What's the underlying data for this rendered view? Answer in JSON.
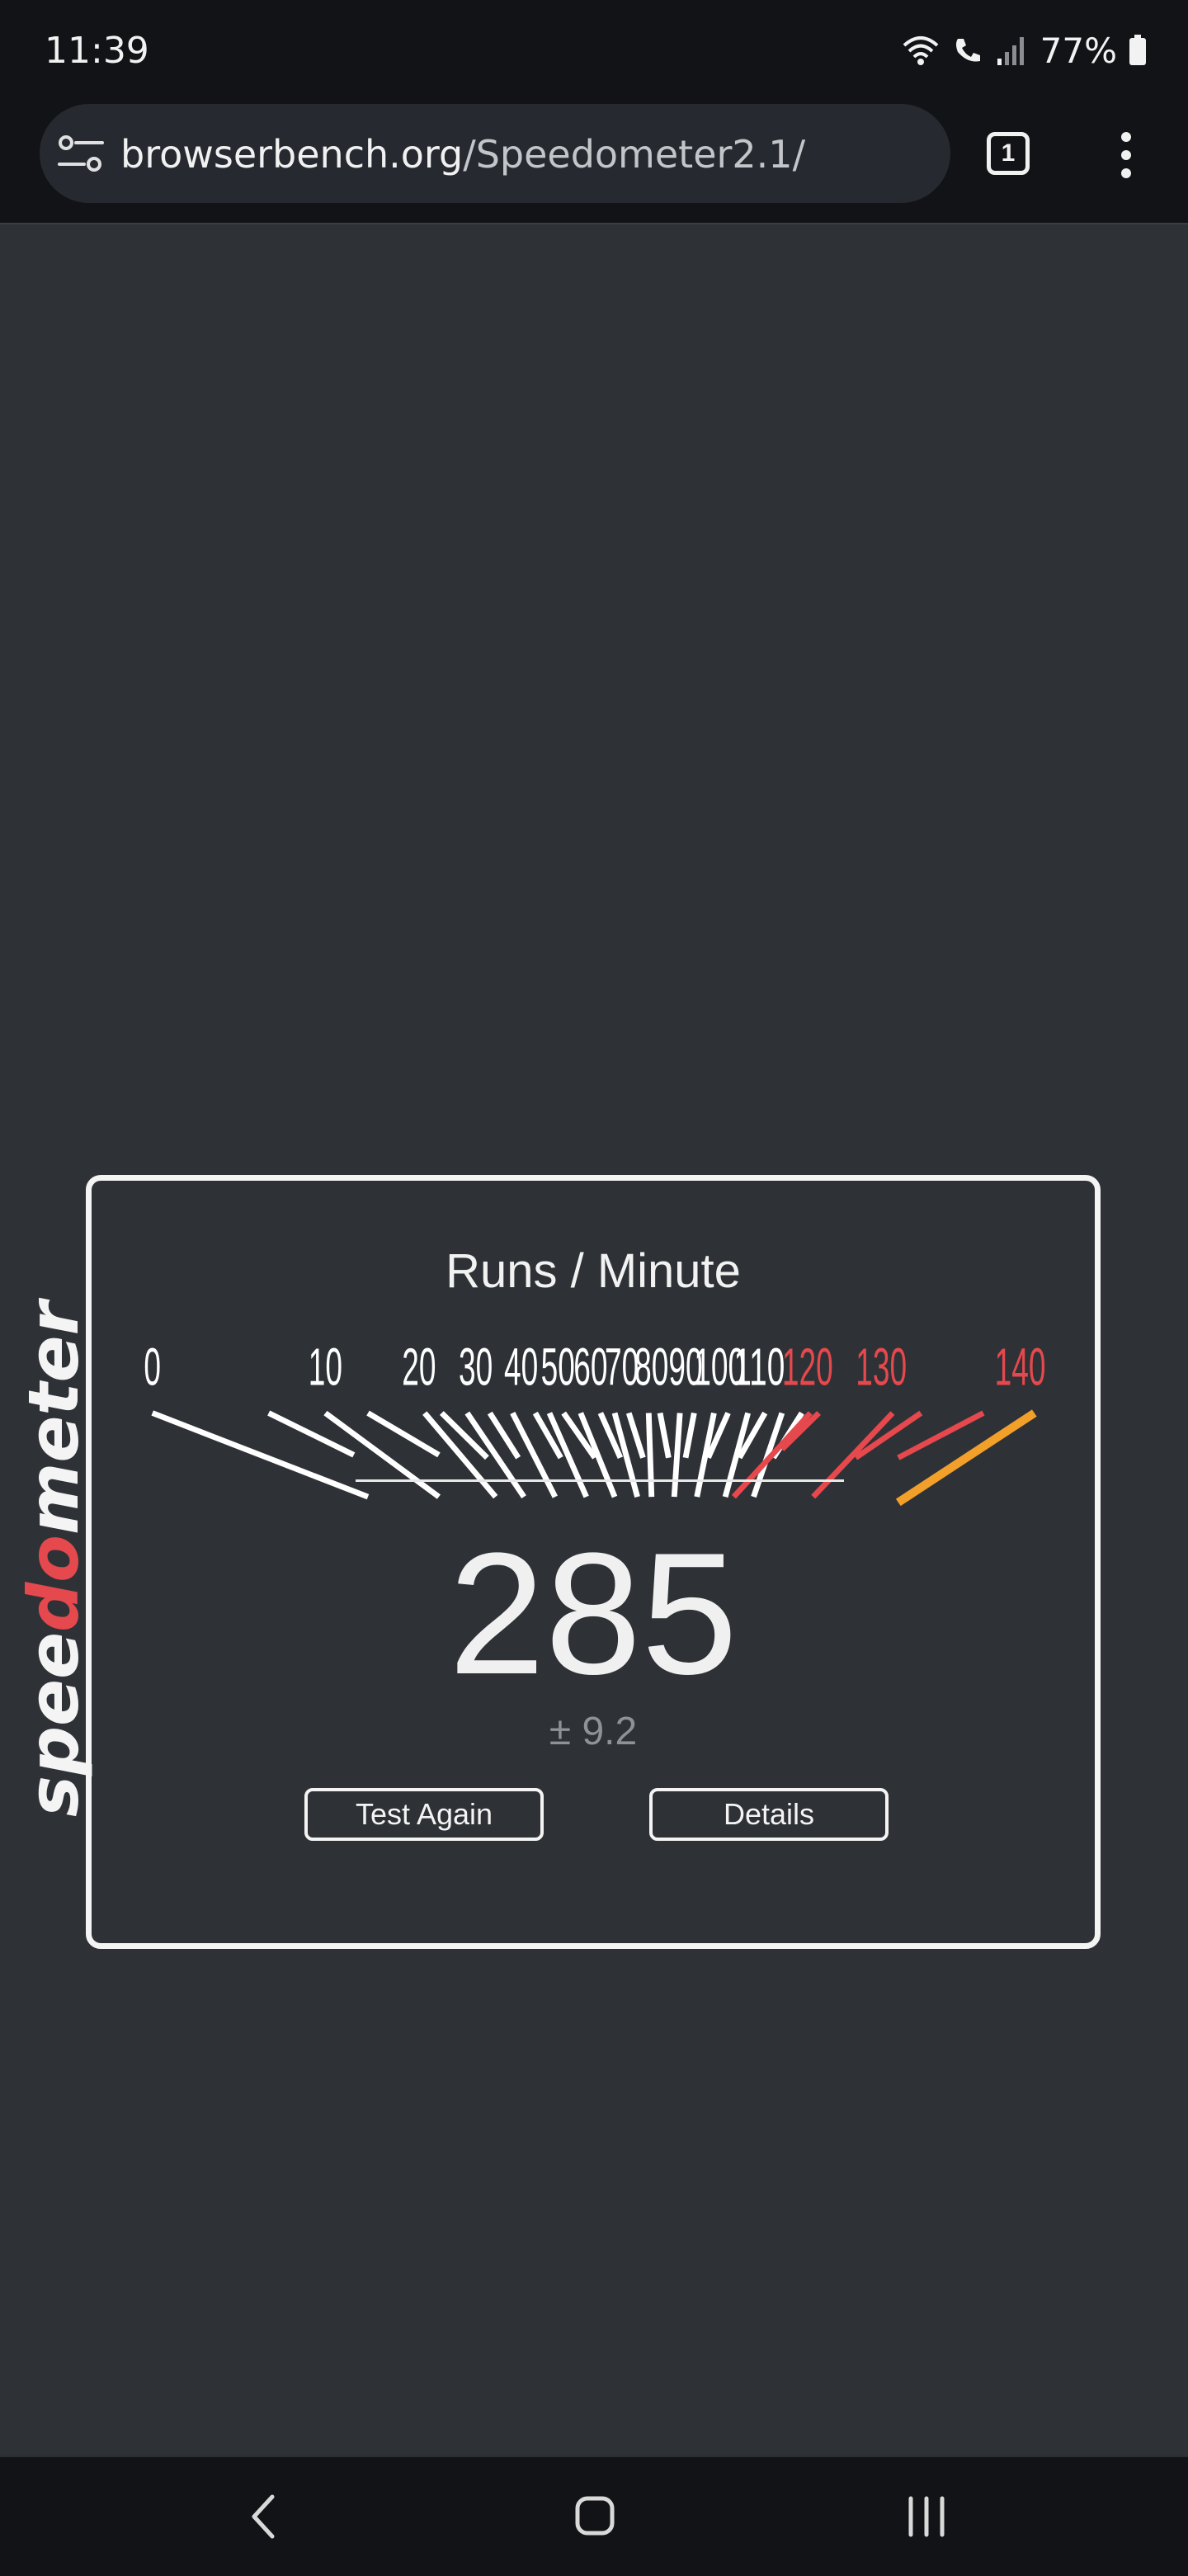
{
  "status_bar": {
    "time": "11:39",
    "battery": "77%"
  },
  "browser": {
    "url_domain": "browserbench.org",
    "url_path": "/Speedometer2.1/",
    "tab_count": "1"
  },
  "logo": {
    "part1": "spee",
    "part2": "d",
    "part3": "o",
    "part4": "meter"
  },
  "result": {
    "title": "Runs / Minute",
    "score": "285",
    "error": "± 9.2",
    "test_again_label": "Test Again",
    "details_label": "Details"
  },
  "gauge": {
    "labels": [
      {
        "text": "0",
        "value": 0,
        "color": "#ffffff"
      },
      {
        "text": "10",
        "value": 10,
        "color": "#ffffff"
      },
      {
        "text": "20",
        "value": 20,
        "color": "#ffffff"
      },
      {
        "text": "30",
        "value": 30,
        "color": "#ffffff"
      },
      {
        "text": "40",
        "value": 40,
        "color": "#ffffff"
      },
      {
        "text": "50",
        "value": 50,
        "color": "#ffffff"
      },
      {
        "text": "60",
        "value": 60,
        "color": "#ffffff"
      },
      {
        "text": "70",
        "value": 70,
        "color": "#ffffff"
      },
      {
        "text": "80",
        "value": 80,
        "color": "#ffffff"
      },
      {
        "text": "90",
        "value": 90,
        "color": "#ffffff"
      },
      {
        "text": "100",
        "value": 100,
        "color": "#ffffff"
      },
      {
        "text": "110",
        "value": 110,
        "color": "#ffffff"
      },
      {
        "text": "120",
        "value": 120,
        "color": "#e5484d"
      },
      {
        "text": "130",
        "value": 130,
        "color": "#e5484d"
      },
      {
        "text": "140",
        "value": 140,
        "color": "#e5484d"
      }
    ],
    "needle_color": "#f2a02a",
    "tick_color": "#ffffff",
    "danger_color": "#e5484d"
  },
  "colors": {
    "background": "#2e3236",
    "accent_red": "#e5484d",
    "accent_orange": "#f2a02a"
  },
  "icons": {
    "site_settings": "tune-icon",
    "tab_switcher": "tab-count-icon",
    "menu": "more-vert-icon",
    "nav_back": "chevron-left-icon",
    "nav_home": "home-square-icon",
    "nav_recents": "recents-icon"
  }
}
